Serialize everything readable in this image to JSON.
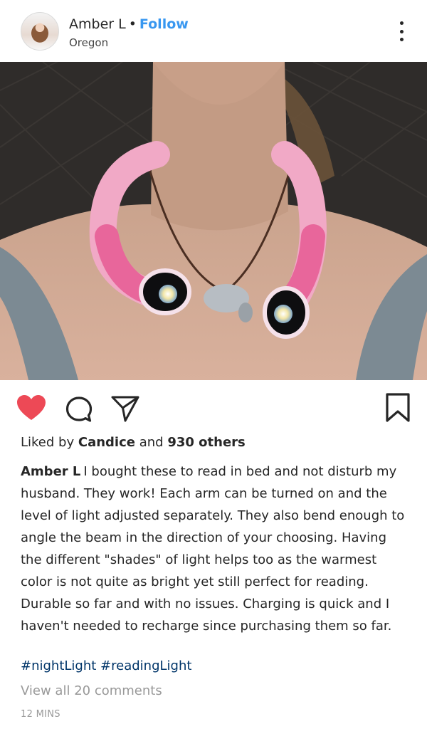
{
  "header": {
    "username": "Amber L",
    "separator": "•",
    "follow_label": "Follow",
    "location": "Oregon"
  },
  "icons": {
    "more": "more-options-icon",
    "like": "heart-icon",
    "comment": "comment-icon",
    "share": "paper-plane-icon",
    "save": "bookmark-icon"
  },
  "colors": {
    "heart": "#ed4956",
    "follow": "#3897f0",
    "hashtag": "#003569",
    "muted": "#999999"
  },
  "likes": {
    "prefix": "Liked by",
    "user": "Candice",
    "and": "and",
    "others": "930 others"
  },
  "caption": {
    "author": "Amber L",
    "text": "I bought these to read in bed and not disturb my husband. They work! Each arm can be turned on and the level of light adjusted separately. They also bend enough to angle the beam in the direction of your choosing. Having the different \"shades\" of light helps too as the warmest color is not quite as bright yet still perfect for reading. Durable so far and with no issues. Charging is quick and I haven't needed to recharge since purchasing them so far.",
    "hashtags": [
      "#nightLight",
      "#readingLight"
    ]
  },
  "comments": {
    "view_all": "View all 20 comments"
  },
  "timestamp": "12 MINS"
}
